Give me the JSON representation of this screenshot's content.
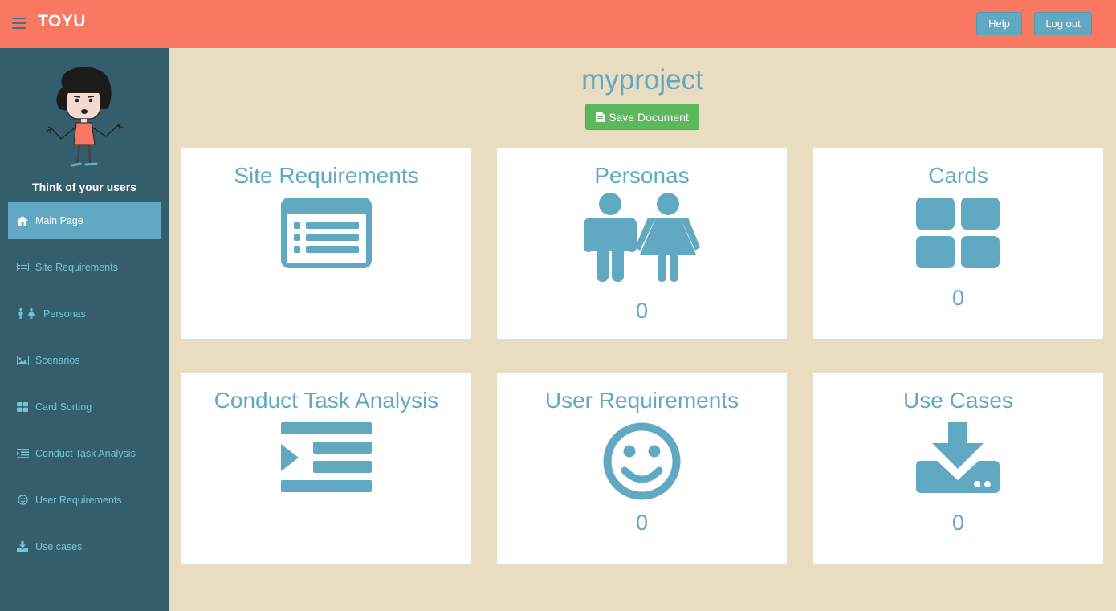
{
  "header": {
    "brand": "TOYU",
    "help_label": "Help",
    "logout_label": "Log out"
  },
  "sidebar": {
    "tagline": "Think of your users",
    "items": [
      {
        "label": "Main Page",
        "icon": "home-icon",
        "active": true
      },
      {
        "label": "Site Requirements",
        "icon": "list-icon"
      },
      {
        "label": "Personas",
        "icon": "male-female-icon"
      },
      {
        "label": "Scenarios",
        "icon": "picture-icon"
      },
      {
        "label": "Card Sorting",
        "icon": "grid-icon"
      },
      {
        "label": "Conduct Task Analysis",
        "icon": "indent-icon"
      },
      {
        "label": "User Requirements",
        "icon": "smiley-icon"
      },
      {
        "label": "Use cases",
        "icon": "download-icon"
      }
    ]
  },
  "main": {
    "project_title": "myproject",
    "save_label": "Save Document",
    "cards": [
      {
        "title": "Site Requirements",
        "icon": "list-icon",
        "count": ""
      },
      {
        "title": "Personas",
        "icon": "male-female-icon",
        "count": "0"
      },
      {
        "title": "Cards",
        "icon": "grid-icon",
        "count": "0"
      },
      {
        "title": "Conduct Task Analysis",
        "icon": "indent-icon",
        "count": ""
      },
      {
        "title": "User Requirements",
        "icon": "smiley-icon",
        "count": "0"
      },
      {
        "title": "Use Cases",
        "icon": "download-icon",
        "count": "0"
      }
    ]
  },
  "colors": {
    "header": "#f87861",
    "sidebar": "#355e6d",
    "accent": "#61a9c3",
    "background": "#e8dcc1",
    "save_button": "#5cb85c"
  }
}
